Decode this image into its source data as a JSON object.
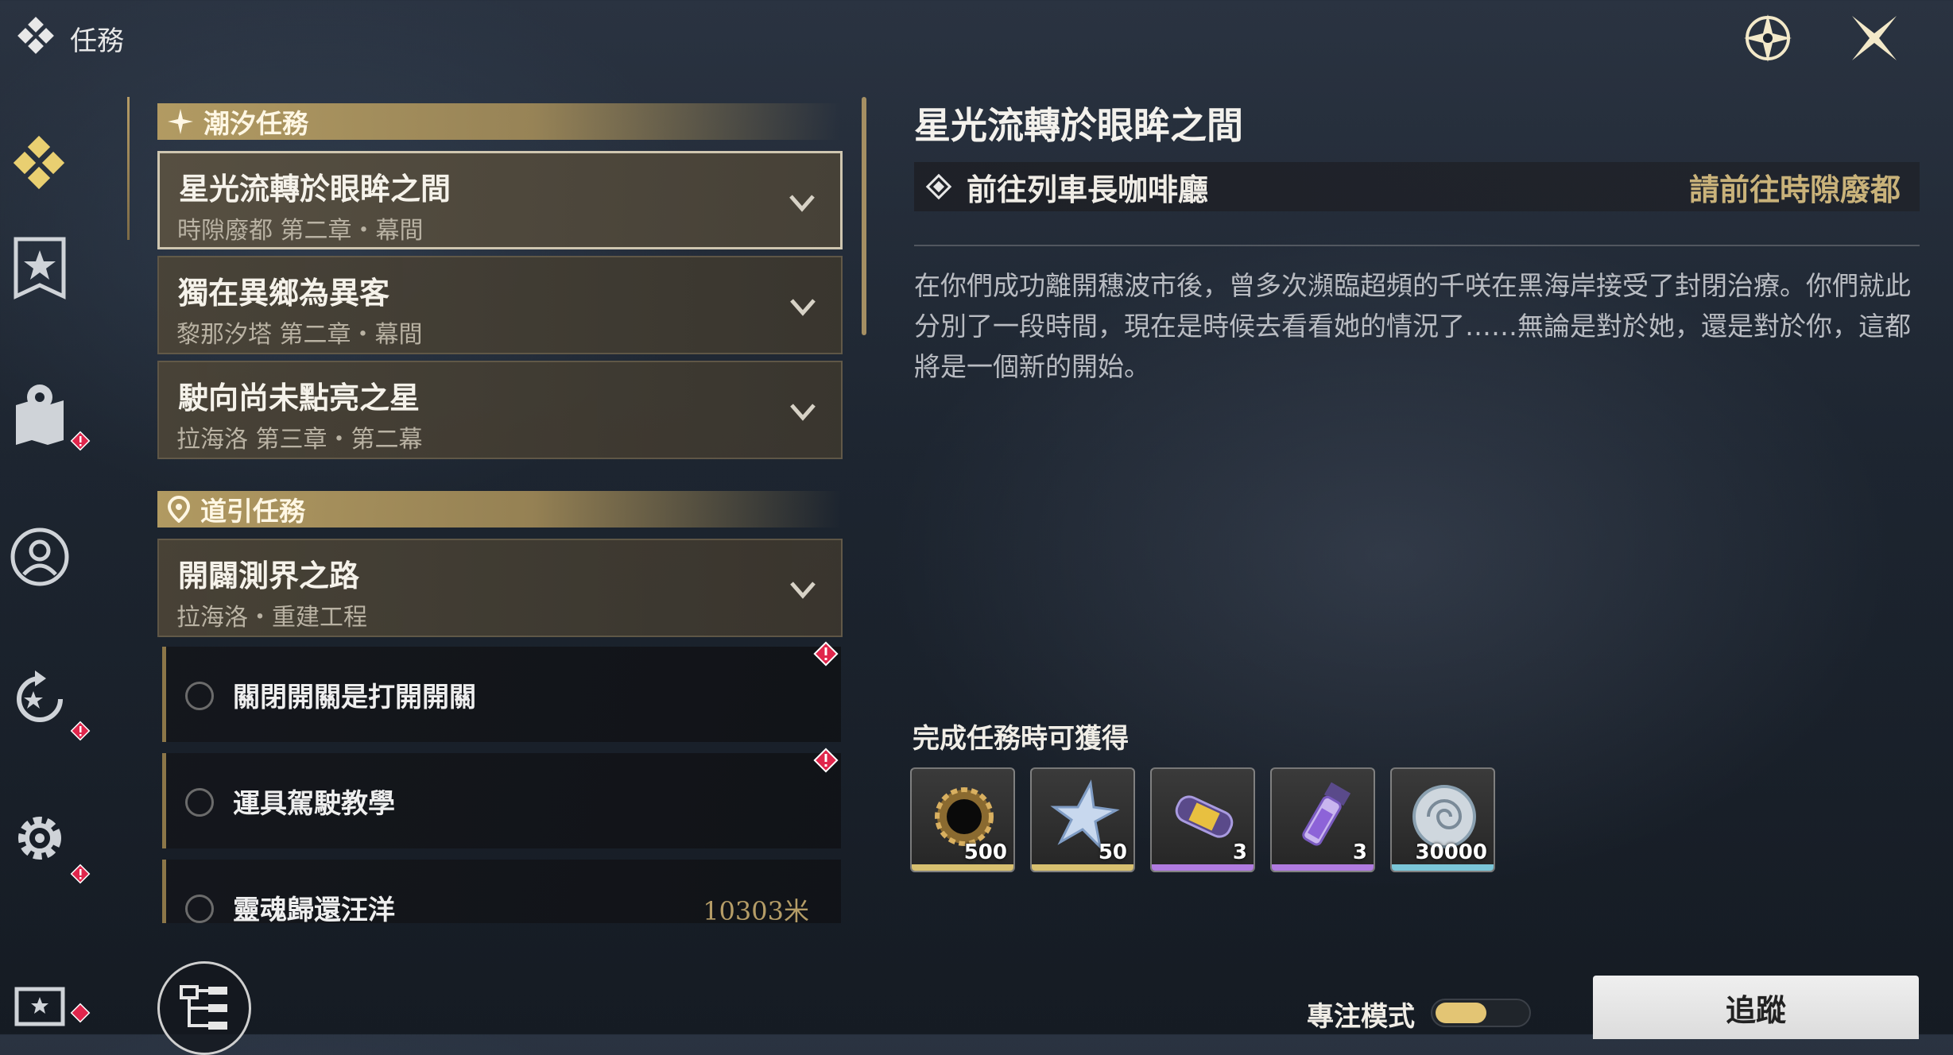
{
  "header": {
    "title": "任務"
  },
  "sections": {
    "tidal": {
      "label": "潮汐任務"
    },
    "guide": {
      "label": "道引任務"
    }
  },
  "quests": [
    {
      "title": "星光流轉於眼眸之間",
      "subtitle": "時隙廢都 第二章・幕間"
    },
    {
      "title": "獨在異鄉為異客",
      "subtitle": "黎那汐塔 第二章・幕間"
    },
    {
      "title": "駛向尚未點亮之星",
      "subtitle": "拉海洛 第三章・第二幕"
    },
    {
      "title": "開闢測界之路",
      "subtitle": "拉海洛・重建工程"
    }
  ],
  "tasks": [
    {
      "label": "關閉開關是打開開關",
      "distance": ""
    },
    {
      "label": "運具駕駛教學",
      "distance": ""
    },
    {
      "label": "靈魂歸還汪洋",
      "distance": "10303米"
    }
  ],
  "detail": {
    "title": "星光流轉於眼眸之間",
    "objective": "前往列車長咖啡廳",
    "objective_hint": "請前往時隙廢都",
    "description": "在你們成功離開穗波市後，曾多次瀕臨超頻的千咲在黑海岸接受了封閉治療。你們就此分別了一段時間，現在是時候去看看她的情況了……無論是對於她，還是對於你，這都將是一個新的開始。",
    "rewards_label": "完成任務時可獲得",
    "rewards": [
      {
        "icon": "gear-ring-icon",
        "amount": "500",
        "quality_color": "#d8c070"
      },
      {
        "icon": "star-crystal-icon",
        "amount": "50",
        "quality_color": "#d8c070"
      },
      {
        "icon": "capsule-icon",
        "amount": "3",
        "quality_color": "#b07be0"
      },
      {
        "icon": "vial-icon",
        "amount": "3",
        "quality_color": "#b07be0"
      },
      {
        "icon": "shell-coin-icon",
        "amount": "30000",
        "quality_color": "#7bc6d8"
      }
    ]
  },
  "footer": {
    "focus_mode_label": "專注模式",
    "track_label": "追蹤"
  },
  "colors": {
    "accent_gold": "#c9b27a",
    "alert_red": "#e0264c"
  }
}
